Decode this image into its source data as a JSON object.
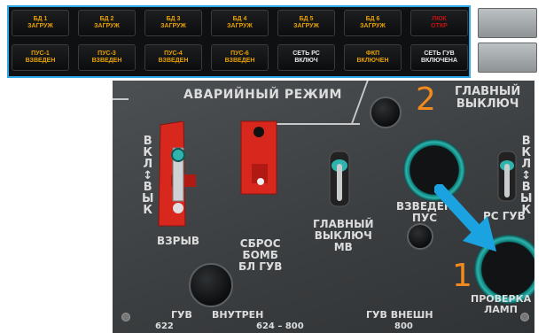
{
  "annunciators": {
    "row1": [
      {
        "text": "БД 1\nЗАГРУЖ",
        "color": "amber"
      },
      {
        "text": "БД 2\nЗАГРУЖ",
        "color": "amber"
      },
      {
        "text": "БД 3\nЗАГРУЖ",
        "color": "amber"
      },
      {
        "text": "БД 4\nЗАГРУЖ",
        "color": "amber"
      },
      {
        "text": "БД 5\nЗАГРУЖ",
        "color": "amber"
      },
      {
        "text": "БД 6\nЗАГРУЖ",
        "color": "amber"
      },
      {
        "text": "ЛЮК\nОТКР",
        "color": "red"
      }
    ],
    "row2": [
      {
        "text": "ПУС-1\nВЗВЕДЕН",
        "color": "amber"
      },
      {
        "text": "ПУС-3\nВЗВЕДЕН",
        "color": "amber"
      },
      {
        "text": "ПУС-4\nВЗВЕДЕН",
        "color": "amber"
      },
      {
        "text": "ПУС-6\nВЗВЕДЕН",
        "color": "amber"
      },
      {
        "text": "СЕТЬ РС\nВКЛЮЧ",
        "color": "white"
      },
      {
        "text": "ФКП\nВКЛЮЧЕН",
        "color": "amber"
      },
      {
        "text": "СЕТЬ ГУВ\nВКЛЮЧЕНА",
        "color": "white"
      }
    ]
  },
  "panel": {
    "emergency_title": "АВАРИЙНЫЙ РЕЖИМ",
    "main_switch_title": "ГЛАВНЫЙ\nВЫКЛЮЧ",
    "on_off_left": "В\nК\nЛ\n↕\nВ\nЫ\nК",
    "on_off_right": "В\nК\nЛ\n↕\nВ\nЫ\nК",
    "explode_label": "ВЗРЫВ",
    "reset_label": "СБРОС\nБОМБ\nБЛ ГУВ",
    "main_mv_label": "ГЛАВНЫЙ\nВЫКЛЮЧ\nМВ",
    "arm_pus_label": "ВЗВЕДЕН\nПУС",
    "rs_guv_label": "РС ГУВ",
    "lamp_test_label": "ПРОВЕРКА\nЛАМП",
    "guv_label": "ГУВ",
    "internal_label": "ВНУТРЕН",
    "guv_external_label": "ГУВ ВНЕШН",
    "num_622": "622",
    "num_624": "624 – 800",
    "num_800": "800",
    "step_1": "1",
    "step_2": "2"
  },
  "colors": {
    "arrow": "#1aa3e0",
    "step_numbers": "#f08a1c",
    "guard": "#d8281e",
    "ring": "#2fb3ad"
  }
}
